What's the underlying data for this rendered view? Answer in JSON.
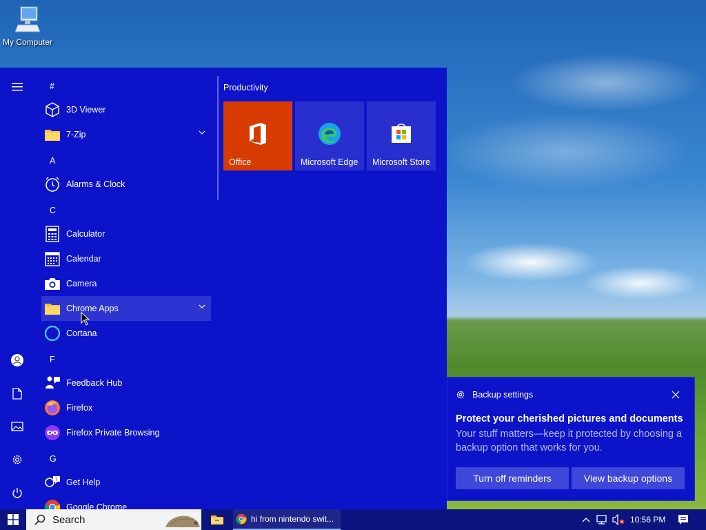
{
  "desktop": {
    "icons": [
      {
        "label": "My Computer",
        "icon": "computer-icon"
      }
    ]
  },
  "start_menu": {
    "rail": {
      "items": [
        "hamburger-icon",
        "user-icon",
        "documents-icon",
        "pictures-icon",
        "settings-icon",
        "power-icon"
      ]
    },
    "app_list": {
      "letter_hash": "#",
      "letter_a": "A",
      "letter_c": "C",
      "letter_f": "F",
      "letter_g": "G",
      "apps": {
        "viewer3d": "3D Viewer",
        "zip7": "7-Zip",
        "alarms": "Alarms & Clock",
        "calculator": "Calculator",
        "calendar": "Calendar",
        "camera": "Camera",
        "chrome_apps": "Chrome Apps",
        "cortana": "Cortana",
        "feedback": "Feedback Hub",
        "firefox": "Firefox",
        "firefox_private": "Firefox Private Browsing",
        "get_help": "Get Help",
        "chrome": "Google Chrome"
      }
    },
    "tiles": {
      "group_title": "Productivity",
      "items": [
        {
          "label": "Office",
          "color": "#d83b01"
        },
        {
          "label": "Microsoft Edge",
          "color": "#0078d4"
        },
        {
          "label": "Microsoft Store",
          "color": "#0078d4"
        }
      ]
    }
  },
  "toast": {
    "app_name": "Backup settings",
    "headline": "Protect your cherished pictures and documents",
    "body": "Your stuff matters—keep it protected by choosing a backup option that works for you.",
    "button_dismiss": "Turn off reminders",
    "button_view": "View backup options"
  },
  "taskbar": {
    "search_placeholder": "Search",
    "window_title": "hi from nintendo swit...",
    "clock": "10:56 PM"
  },
  "colors": {
    "start_bg": "#0c13c9",
    "taskbar_bg": "#0c1480",
    "toast_button": "#3f47da",
    "office_tile": "#d83b01"
  }
}
